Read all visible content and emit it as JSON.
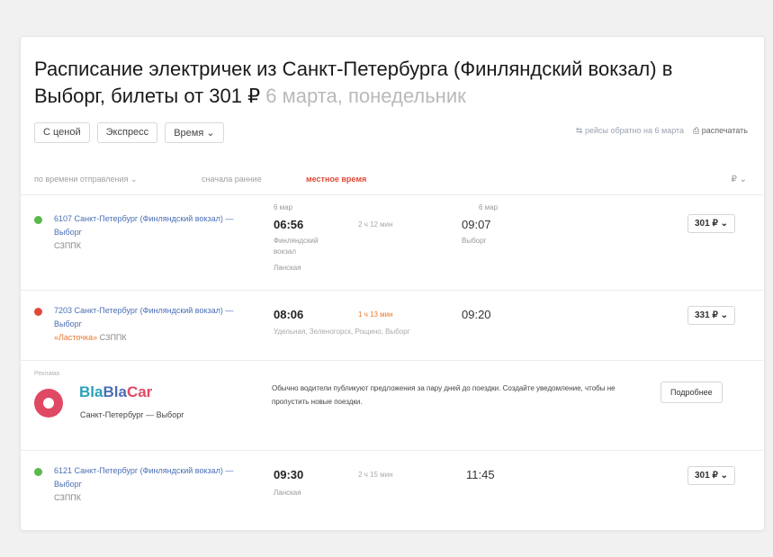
{
  "header": {
    "title_main": "Расписание электричек из Санкт-Петербурга (Финляндский вокзал) в Выборг, билеты от 301 ₽",
    "title_date": "6 марта, понедельник"
  },
  "filters": [
    "С ценой",
    "Экспресс",
    "Время"
  ],
  "topbar": {
    "return_link": "рейсы обратно на 6 марта",
    "print": "распечатать"
  },
  "sort": {
    "by_departure": "по времени отправления",
    "by_arrival": "сначала ранние",
    "local_time": "местное время",
    "currency": "₽"
  },
  "trains": [
    {
      "number": "6107",
      "route": "Санкт-Петербург (Финляндский вокзал) — Выборг",
      "label": "",
      "operator": "СЗППК",
      "dep_date": "6 мар",
      "dep_time": "06:56",
      "dep_station": "Финляндский вокзал",
      "dep_note": "Ланская",
      "duration": "2 ч 12 мин",
      "arr_date": "6 мар",
      "arr_time": "09:07",
      "arr_station": "Выборг",
      "stops": "",
      "price": "301 ₽",
      "status_color": "#59b94a"
    },
    {
      "number": "7203",
      "route": "Санкт-Петербург (Финляндский вокзал) — Выборг",
      "label": "«Ласточка»",
      "operator": "СЗППК",
      "dep_date": "",
      "dep_time": "08:06",
      "dep_station": "",
      "dep_note": "",
      "duration": "1 ч 13 мин",
      "arr_date": "",
      "arr_time": "09:20",
      "arr_station": "",
      "stops": "Удельная, Зеленогорск, Рощино, Выборг",
      "price": "331 ₽",
      "status_color": "#e04a3a"
    },
    {
      "number": "6121",
      "route": "Санкт-Петербург (Финляндский вокзал) — Выборг",
      "label": "",
      "operator": "СЗППК",
      "dep_date": "",
      "dep_time": "09:30",
      "dep_station": "",
      "dep_note": "Ланская",
      "duration": "2 ч 15 мин",
      "arr_date": "",
      "arr_time": "11:45",
      "arr_station": "",
      "stops": "",
      "price": "301 ₽",
      "status_color": "#59b94a"
    }
  ],
  "ad": {
    "label": "Реклама",
    "brand_1": "Bla",
    "brand_2": "Bla",
    "brand_3": "Car",
    "route": "Санкт-Петербург — Выборг",
    "text": "Обычно водители публикуют предложения за пару дней до поездки. Создайте уведомление, чтобы не пропустить новые поездки.",
    "button": "Подробнее"
  }
}
